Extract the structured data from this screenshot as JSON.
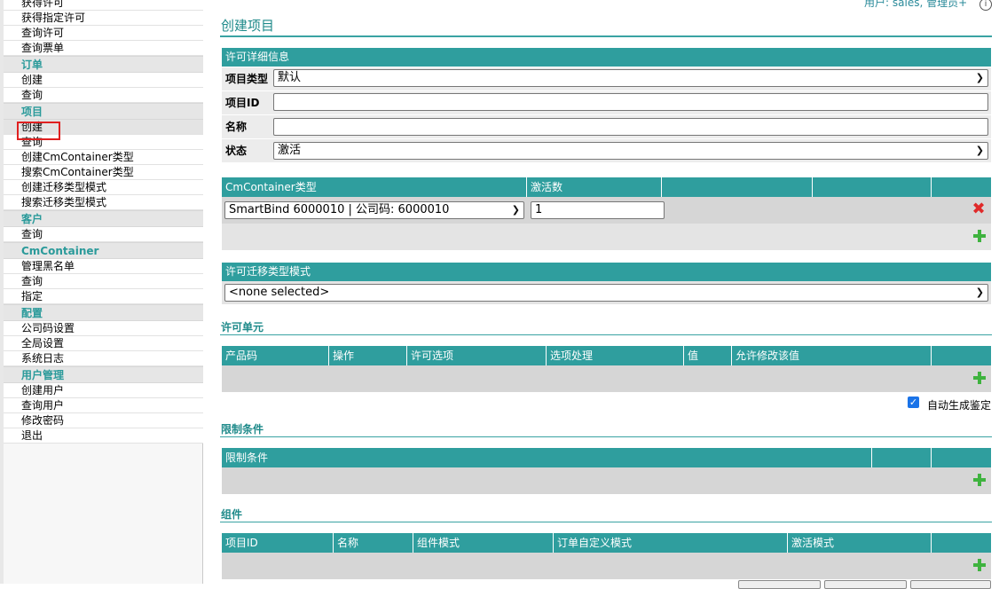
{
  "sidebar": {
    "links_top": [
      "获得许可",
      "获得指定许可",
      "查询许可",
      "查询票单"
    ],
    "order": {
      "title": "订单",
      "items": [
        "创建",
        "查询"
      ]
    },
    "project": {
      "title": "项目",
      "items": [
        "创建",
        "查询",
        "创建CmContainer类型",
        "搜索CmContainer类型",
        "创建迁移类型模式",
        "搜索迁移类型模式"
      ]
    },
    "customer": {
      "title": "客户",
      "items": [
        "查询"
      ]
    },
    "cmcontainer": {
      "title": "CmContainer",
      "items": [
        "管理黑名单",
        "查询",
        "指定"
      ]
    },
    "config": {
      "title": "配置",
      "items": [
        "公司码设置",
        "全局设置",
        "系统日志"
      ]
    },
    "user_mgmt": {
      "title": "用户管理",
      "items": [
        "创建用户",
        "查询用户",
        "修改密码",
        "退出"
      ]
    }
  },
  "header": {
    "user_text": "用户: sales, 管理员+",
    "info_glyph": "i",
    "page_title": "创建项目"
  },
  "license_details": {
    "title": "许可详细信息",
    "project_type_label": "项目类型",
    "project_type_value": "默认",
    "project_id_label": "项目ID",
    "project_id_value": "",
    "name_label": "名称",
    "name_value": "",
    "status_label": "状态",
    "status_value": "激活"
  },
  "cmcontainer_table": {
    "headers": [
      "CmContainer类型",
      "激活数"
    ],
    "row": {
      "type_value": "SmartBind 6000010 | 公司码: 6000010",
      "activations": "1"
    }
  },
  "migration": {
    "title": "许可迁移类型模式",
    "value": "<none selected>"
  },
  "license_units": {
    "title": "许可单元",
    "headers": [
      "产品码",
      "操作",
      "许可选项",
      "选项处理",
      "值",
      "允许修改该值"
    ],
    "auto_label": "自动生成鉴定"
  },
  "restrictions": {
    "title": "限制条件",
    "headers": [
      "限制条件"
    ]
  },
  "components": {
    "title": "组件",
    "headers": [
      "项目ID",
      "名称",
      "组件模式",
      "订单自定义模式",
      "激活模式"
    ]
  },
  "icons": {
    "add": "plus-icon",
    "delete": "delete-icon",
    "dropdown": "chevron-down-icon"
  },
  "colors": {
    "accent": "#2f9e9e",
    "title": "#1f8a8a",
    "add": "#3fb33f",
    "delete": "#e02a2a"
  }
}
